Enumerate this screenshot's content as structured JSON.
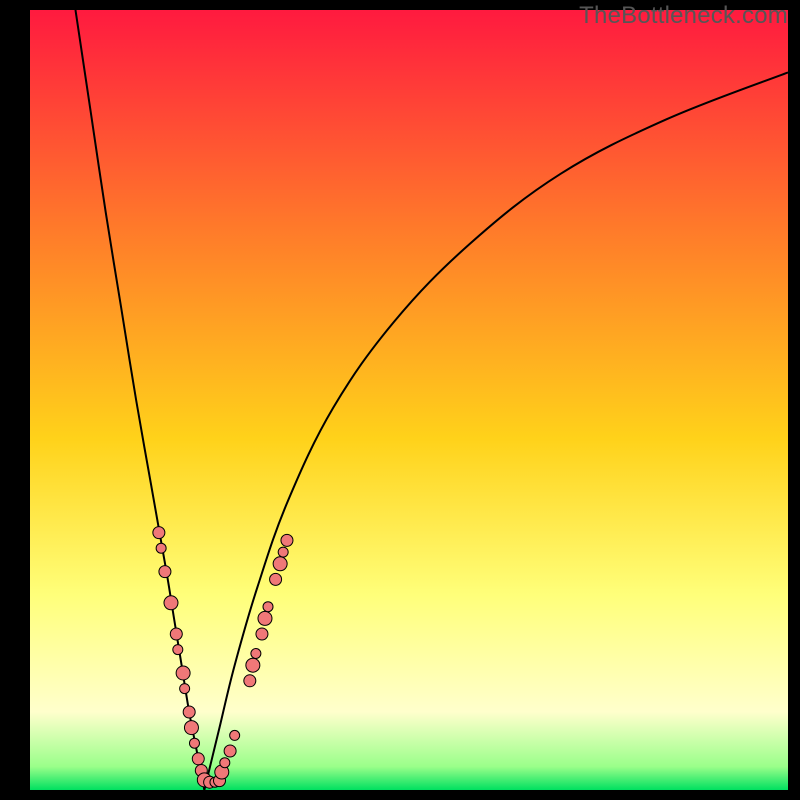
{
  "watermark": "TheBottleneck.com",
  "colors": {
    "gradient_top": "#ff1a3f",
    "gradient_mid_upper": "#ff7a2a",
    "gradient_mid": "#ffd21a",
    "gradient_lower": "#ffff7a",
    "gradient_near_bottom": "#ffffcc",
    "gradient_bottom": "#00e060",
    "curve": "#000000",
    "dot_fill": "#f07878",
    "dot_stroke": "#000000",
    "frame_bg": "#000000"
  },
  "chart_data": {
    "type": "line",
    "title": "",
    "xlabel": "",
    "ylabel": "",
    "xlim": [
      0,
      100
    ],
    "ylim": [
      0,
      100
    ],
    "optimum_x": 23,
    "series": [
      {
        "name": "left-curve",
        "x": [
          6,
          8,
          10,
          12,
          14,
          16,
          18,
          19,
          20,
          21,
          22,
          23
        ],
        "y": [
          100,
          87,
          74,
          62,
          50,
          39,
          28,
          22,
          16,
          10,
          5,
          0
        ]
      },
      {
        "name": "right-curve",
        "x": [
          23,
          24,
          25,
          27,
          30,
          34,
          40,
          48,
          58,
          70,
          84,
          100
        ],
        "y": [
          0,
          4,
          8,
          16,
          26,
          37,
          49,
          60,
          70,
          79,
          86,
          92
        ]
      }
    ],
    "scatter": {
      "name": "sample-points",
      "points": [
        {
          "x": 17.0,
          "y": 33,
          "r": 6
        },
        {
          "x": 17.3,
          "y": 31,
          "r": 5
        },
        {
          "x": 17.8,
          "y": 28,
          "r": 6
        },
        {
          "x": 18.6,
          "y": 24,
          "r": 7
        },
        {
          "x": 19.3,
          "y": 20,
          "r": 6
        },
        {
          "x": 19.5,
          "y": 18,
          "r": 5
        },
        {
          "x": 20.2,
          "y": 15,
          "r": 7
        },
        {
          "x": 20.4,
          "y": 13,
          "r": 5
        },
        {
          "x": 21.0,
          "y": 10,
          "r": 6
        },
        {
          "x": 21.3,
          "y": 8,
          "r": 7
        },
        {
          "x": 21.7,
          "y": 6,
          "r": 5
        },
        {
          "x": 22.2,
          "y": 4,
          "r": 6
        },
        {
          "x": 22.6,
          "y": 2.5,
          "r": 6
        },
        {
          "x": 23.0,
          "y": 1.3,
          "r": 7
        },
        {
          "x": 23.7,
          "y": 1.0,
          "r": 6
        },
        {
          "x": 24.4,
          "y": 1.0,
          "r": 5
        },
        {
          "x": 25.0,
          "y": 1.2,
          "r": 6
        },
        {
          "x": 25.3,
          "y": 2.3,
          "r": 7
        },
        {
          "x": 25.7,
          "y": 3.5,
          "r": 5
        },
        {
          "x": 26.4,
          "y": 5,
          "r": 6
        },
        {
          "x": 27.0,
          "y": 7,
          "r": 5
        },
        {
          "x": 29.0,
          "y": 14,
          "r": 6
        },
        {
          "x": 29.4,
          "y": 16,
          "r": 7
        },
        {
          "x": 29.8,
          "y": 17.5,
          "r": 5
        },
        {
          "x": 30.6,
          "y": 20,
          "r": 6
        },
        {
          "x": 31.0,
          "y": 22,
          "r": 7
        },
        {
          "x": 31.4,
          "y": 23.5,
          "r": 5
        },
        {
          "x": 32.4,
          "y": 27,
          "r": 6
        },
        {
          "x": 33.0,
          "y": 29,
          "r": 7
        },
        {
          "x": 33.4,
          "y": 30.5,
          "r": 5
        },
        {
          "x": 33.9,
          "y": 32,
          "r": 6
        }
      ]
    }
  }
}
